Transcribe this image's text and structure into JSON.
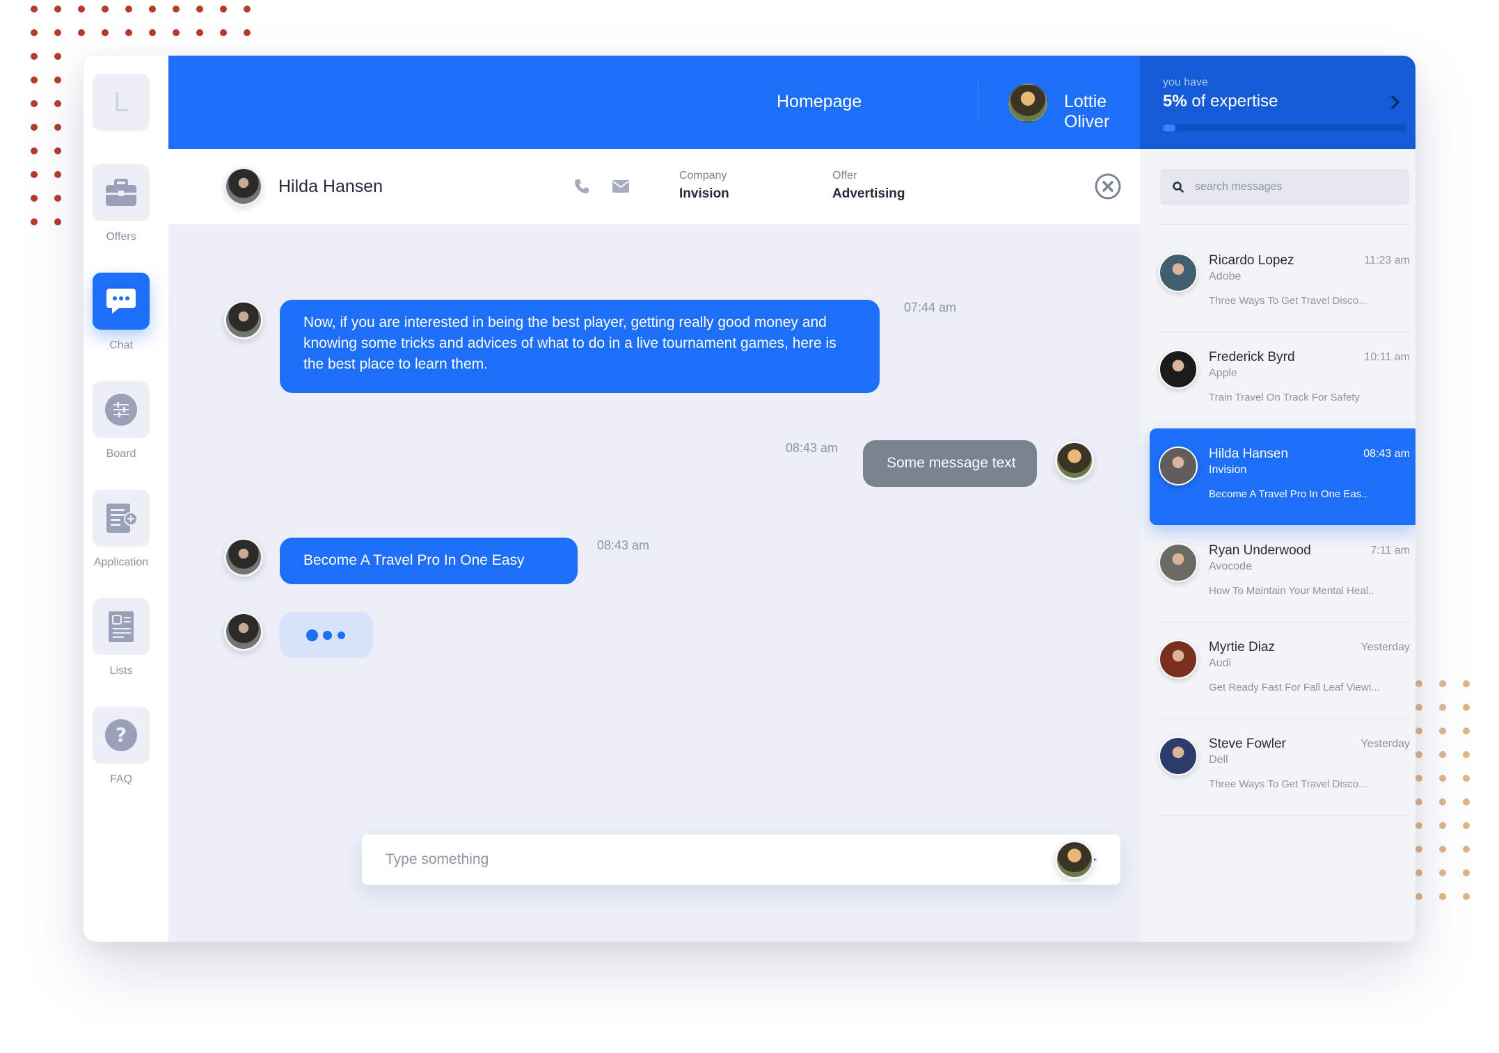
{
  "rail": {
    "logo": "L",
    "items": [
      {
        "label": "Offers",
        "icon": "briefcase-icon"
      },
      {
        "label": "Chat",
        "icon": "chat-bubble-icon",
        "active": true
      },
      {
        "label": "Board",
        "icon": "sliders-icon"
      },
      {
        "label": "Application",
        "icon": "document-add-icon"
      },
      {
        "label": "Lists",
        "icon": "id-card-icon"
      },
      {
        "label": "FAQ",
        "icon": "question-icon"
      }
    ]
  },
  "header": {
    "homepage": "Homepage",
    "user_name": "Lottie Oliver",
    "expertise_sub": "you have",
    "expertise_value": "5%",
    "expertise_text": " of expertise",
    "progress_fraction": 0.05
  },
  "conversation": {
    "name": "Hilda Hansen",
    "company_label": "Company",
    "company_value": "Invision",
    "offer_label": "Offer",
    "offer_value": "Advertising"
  },
  "messages": [
    {
      "text": "Now, if you are interested in being the best player, getting really good money and knowing some tricks and advices of what to do in a live tournament games, here is the best place to learn them.",
      "time": "07:44 am"
    },
    {
      "text": "Some message text",
      "time": "08:43 am"
    },
    {
      "text": "Become A Travel Pro In One Easy",
      "time": "08:43 am"
    }
  ],
  "composer": {
    "placeholder": "Type something"
  },
  "search": {
    "placeholder": "search messages"
  },
  "contacts": [
    {
      "name": "Ricardo Lopez",
      "time": "11:23 am",
      "company": "Adobe",
      "preview": "Three Ways To Get Travel Disco...",
      "avatar_color": "#3f5f6e"
    },
    {
      "name": "Frederick Byrd",
      "time": "10:11 am",
      "company": "Apple",
      "preview": "Train Travel On Track For Safety",
      "avatar_color": "#1b1b1b"
    },
    {
      "name": "Hilda Hansen",
      "time": "08:43 am",
      "company": "Invision",
      "preview": "Become A Travel Pro In One Eas..",
      "avatar_color": "#5f5e5b",
      "active": true
    },
    {
      "name": "Ryan Underwood",
      "time": "7:11 am",
      "company": "Avocode",
      "preview": "How To Maintain Your Mental Heal..",
      "avatar_color": "#6d6a66"
    },
    {
      "name": "Myrtie Diaz",
      "time": "Yesterday",
      "company": "Audi",
      "preview": "Get Ready Fast For Fall Leaf Viewi...",
      "avatar_color": "#7a2f1f"
    },
    {
      "name": "Steve Fowler",
      "time": "Yesterday",
      "company": "Dell",
      "preview": "Three Ways To Get Travel Disco...",
      "avatar_color": "#2c3d6b"
    }
  ],
  "colors": {
    "accent": "#1d6ff7",
    "accent_dark": "#165bd6",
    "bubble_grey": "#78838f"
  }
}
